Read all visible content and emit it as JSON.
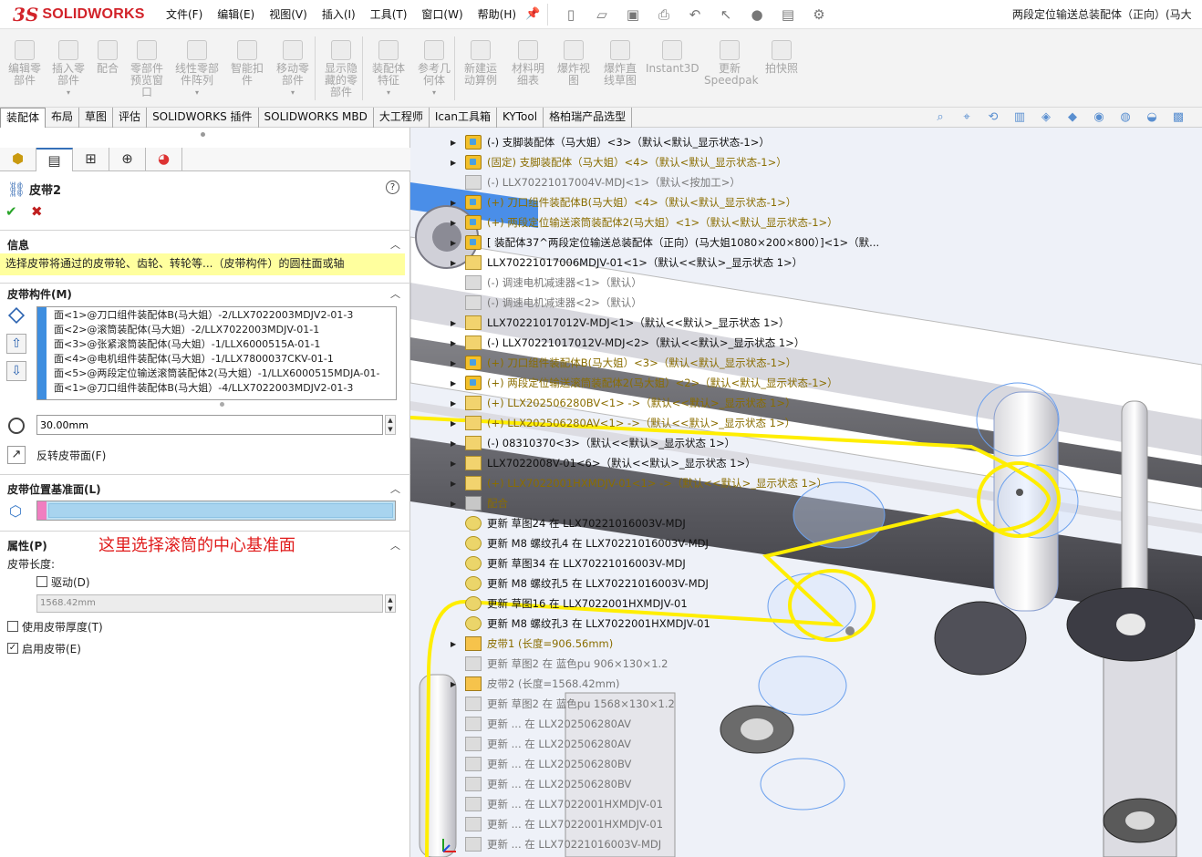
{
  "titlebar": {
    "logo_ds": "3S",
    "logo_text": "SOLIDWORKS",
    "menus": [
      "文件(F)",
      "编辑(E)",
      "视图(V)",
      "插入(I)",
      "工具(T)",
      "窗口(W)",
      "帮助(H)"
    ],
    "pin_icon": "pin-icon",
    "document_title": "两段定位输送总装配体（正向）(马大"
  },
  "ribbon": {
    "buttons": [
      {
        "label": "编辑零\n部件",
        "icon": "edit-component-icon"
      },
      {
        "label": "插入零\n部件",
        "icon": "insert-component-icon"
      },
      {
        "label": "配合",
        "icon": "mate-icon"
      },
      {
        "label": "零部件\n预览窗\n口",
        "icon": "preview-window-icon"
      },
      {
        "label": "线性零部\n件阵列",
        "icon": "linear-pattern-icon"
      },
      {
        "label": "智能扣\n件",
        "icon": "smart-fastener-icon"
      },
      {
        "label": "移动零\n部件",
        "icon": "move-component-icon"
      },
      {
        "label": "显示隐\n藏的零\n部件",
        "icon": "show-hidden-icon"
      },
      {
        "label": "装配体\n特征",
        "icon": "assembly-feature-icon"
      },
      {
        "label": "参考几\n何体",
        "icon": "reference-geometry-icon"
      },
      {
        "label": "新建运\n动算例",
        "icon": "motion-study-icon"
      },
      {
        "label": "材料明\n细表",
        "icon": "bom-icon"
      },
      {
        "label": "爆炸视\n图",
        "icon": "exploded-view-icon"
      },
      {
        "label": "爆炸直\n线草图",
        "icon": "explode-line-icon"
      },
      {
        "label": "Instant3D",
        "icon": "instant3d-icon"
      },
      {
        "label": "更新\nSpeedpak",
        "icon": "speedpak-icon"
      },
      {
        "label": "拍快照",
        "icon": "snapshot-icon"
      }
    ]
  },
  "tabs": [
    "装配体",
    "布局",
    "草图",
    "评估",
    "SOLIDWORKS 插件",
    "SOLIDWORKS MBD",
    "大工程师",
    "Ican工具箱",
    "KYTool",
    "格柏瑞产品选型"
  ],
  "property_manager": {
    "title": "皮带2",
    "info": {
      "header": "信息",
      "message": "选择皮带将通过的皮带轮、齿轮、转轮等...（皮带构件）的圆柱面或轴"
    },
    "members": {
      "header": "皮带构件(M)",
      "items": [
        "面<1>@刀口组件装配体B(马大姐）-2/LLX7022003MDJV2-01-3",
        "面<2>@滚筒装配体(马大姐）-2/LLX7022003MDJV-01-1",
        "面<3>@张紧滚筒装配体(马大姐）-1/LLX6000515A-01-1",
        "面<4>@电机组件装配体(马大姐）-1/LLX7800037CKV-01-1",
        "面<5>@两段定位输送滚筒装配体2(马大姐）-1/LLX6000515MDJA-01-",
        "面<1>@刀口组件装配体B(马大姐）-4/LLX7022003MDJV2-01-3"
      ],
      "diameter": "30.00mm",
      "flip_label": "反转皮带面(F)"
    },
    "position_plane": {
      "header": "皮带位置基准面(L)"
    },
    "annotation": "这里选择滚筒的中心基准面",
    "properties": {
      "header": "属性(P)",
      "length_label": "皮带长度:",
      "driving_label": "驱动(D)",
      "driving_checked": false,
      "length_value": "1568.42mm",
      "thickness_label": "使用皮带厚度(T)",
      "thickness_checked": false,
      "enable_label": "启用皮带(E)",
      "enable_checked": true,
      "check_mark": "✓"
    }
  },
  "feature_tree": [
    {
      "text": "(-) 支脚装配体（马大姐）<3>（默认<默认_显示状态-1>）",
      "icon": "asm",
      "exp": "▶",
      "style": ""
    },
    {
      "text": "(固定) 支脚装配体（马大姐）<4>（默认<默认_显示状态-1>）",
      "icon": "asm",
      "exp": "▶",
      "style": "fixed"
    },
    {
      "text": "(-) LLX70221017004V-MDJ<1>（默认<按加工>）",
      "icon": "ghost",
      "exp": "",
      "style": "grey"
    },
    {
      "text": "(+) 刀口组件装配体B(马大姐）<4>（默认<默认_显示状态-1>）",
      "icon": "asm",
      "exp": "▶",
      "style": "warn"
    },
    {
      "text": "(+) 两段定位输送滚筒装配体2(马大姐）<1>（默认<默认_显示状态-1>）",
      "icon": "asm",
      "exp": "▶",
      "style": "warn"
    },
    {
      "text": "[ 装配体37^两段定位输送总装配体（正向）(马大姐1080×200×800）]<1>（默...",
      "icon": "asm",
      "exp": "▶",
      "style": ""
    },
    {
      "text": "LLX70221017006MDJV-01<1>（默认<<默认>_显示状态 1>）",
      "icon": "part",
      "exp": "▶",
      "style": ""
    },
    {
      "text": "(-) 调速电机减速器<1>（默认）",
      "icon": "ghost",
      "exp": "",
      "style": "grey"
    },
    {
      "text": "(-) 调速电机减速器<2>（默认）",
      "icon": "ghost",
      "exp": "",
      "style": "grey"
    },
    {
      "text": "LLX70221017012V-MDJ<1>（默认<<默认>_显示状态 1>）",
      "icon": "part",
      "exp": "▶",
      "style": ""
    },
    {
      "text": "(-) LLX70221017012V-MDJ<2>（默认<<默认>_显示状态 1>）",
      "icon": "part",
      "exp": "▶",
      "style": ""
    },
    {
      "text": "(+) 刀口组件装配体B(马大姐）<3>（默认<默认_显示状态-1>）",
      "icon": "asm",
      "exp": "▶",
      "style": "warn"
    },
    {
      "text": "(+) 两段定位输送滚筒装配体2(马大姐）<2>（默认<默认_显示状态-1>）",
      "icon": "asm",
      "exp": "▶",
      "style": "warn"
    },
    {
      "text": "(+) LLX202506280BV<1> ->（默认<<默认>_显示状态 1>）",
      "icon": "part",
      "exp": "▶",
      "style": "warn"
    },
    {
      "text": "(+) LLX202506280AV<1> ->（默认<<默认>_显示状态 1>）",
      "icon": "part",
      "exp": "▶",
      "style": "warn"
    },
    {
      "text": "(-) 08310370<3>（默认<<默认>_显示状态 1>）",
      "icon": "part",
      "exp": "▶",
      "style": ""
    },
    {
      "text": "LLX7022008V-01<6>（默认<<默认>_显示状态 1>）",
      "icon": "part",
      "exp": "▶",
      "style": ""
    },
    {
      "text": "(+) LLX7022001HXMDJV-01<1> ->（默认<<默认>_显示状态 1>）",
      "icon": "part",
      "exp": "▶",
      "style": "warn"
    },
    {
      "text": "配合",
      "icon": "mate",
      "exp": "▶",
      "style": "warn"
    },
    {
      "text": "更新 草图24 在 LLX70221016003V-MDJ",
      "icon": "sketch",
      "exp": "",
      "style": ""
    },
    {
      "text": "更新 M8 螺纹孔4 在 LLX70221016003V-MDJ",
      "icon": "sketch",
      "exp": "",
      "style": ""
    },
    {
      "text": "更新 草图34 在 LLX70221016003V-MDJ",
      "icon": "sketch",
      "exp": "",
      "style": ""
    },
    {
      "text": "更新 M8 螺纹孔5 在 LLX70221016003V-MDJ",
      "icon": "sketch",
      "exp": "",
      "style": ""
    },
    {
      "text": "更新 草图16 在 LLX7022001HXMDJV-01",
      "icon": "sketch",
      "exp": "",
      "style": ""
    },
    {
      "text": "更新 M8 螺纹孔3 在 LLX7022001HXMDJV-01",
      "icon": "sketch",
      "exp": "",
      "style": ""
    },
    {
      "text": "皮带1 (长度=906.56mm)",
      "icon": "belt",
      "exp": "▶",
      "style": "warn"
    },
    {
      "text": "更新 草图2 在 蓝色pu 906×130×1.2",
      "icon": "ghost",
      "exp": "",
      "style": "grey"
    },
    {
      "text": "皮带2 (长度=1568.42mm)",
      "icon": "belt",
      "exp": "▶",
      "style": "grey"
    },
    {
      "text": "更新 草图2 在 蓝色pu 1568×130×1.2",
      "icon": "ghost",
      "exp": "",
      "style": "grey"
    },
    {
      "text": "更新 ... 在 LLX202506280AV",
      "icon": "ghost",
      "exp": "",
      "style": "grey"
    },
    {
      "text": "更新 ... 在 LLX202506280AV",
      "icon": "ghost",
      "exp": "",
      "style": "grey"
    },
    {
      "text": "更新 ... 在 LLX202506280BV",
      "icon": "ghost",
      "exp": "",
      "style": "grey"
    },
    {
      "text": "更新 ... 在 LLX202506280BV",
      "icon": "ghost",
      "exp": "",
      "style": "grey"
    },
    {
      "text": "更新 ... 在 LLX7022001HXMDJV-01",
      "icon": "ghost",
      "exp": "",
      "style": "grey"
    },
    {
      "text": "更新 ... 在 LLX7022001HXMDJV-01",
      "icon": "ghost",
      "exp": "",
      "style": "grey"
    },
    {
      "text": "更新 ... 在 LLX70221016003V-MDJ",
      "icon": "ghost",
      "exp": "",
      "style": "grey"
    }
  ],
  "colors": {
    "brand_red": "#d2232a",
    "belt_yellow": "#ffee00",
    "selection_blue": "#3e8ee0",
    "annotation_red": "#e01b1b"
  }
}
